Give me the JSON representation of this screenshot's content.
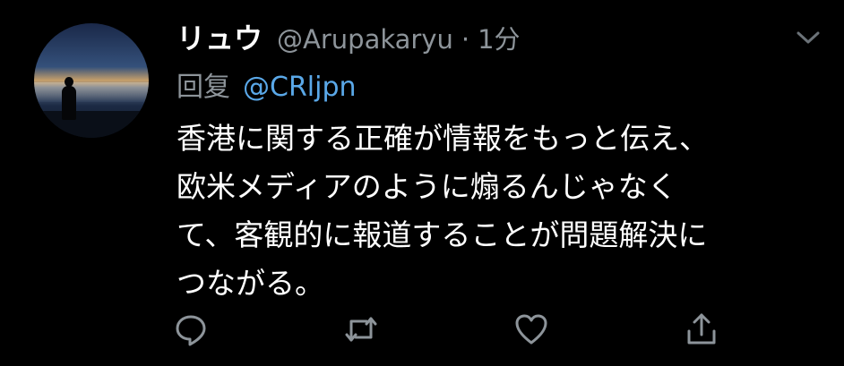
{
  "tweet": {
    "display_name": "リュウ",
    "handle": "@Arupakaryu",
    "separator": "·",
    "time": "1分",
    "reply_label": "回复",
    "reply_to": "@CRljpn",
    "body_lines": [
      "香港に関する正確が情報をもっと伝え、",
      "欧米メディアのように煽るんじゃなく",
      "て、客観的に報道することが問題解決に",
      "つながる。"
    ]
  },
  "icons": {
    "menu": "chevron-down-icon",
    "reply": "reply-icon",
    "retweet": "retweet-icon",
    "like": "heart-icon",
    "share": "share-icon"
  },
  "colors": {
    "background": "#000000",
    "text": "#ffffff",
    "muted": "#8d949a",
    "link": "#5aa8e8"
  }
}
